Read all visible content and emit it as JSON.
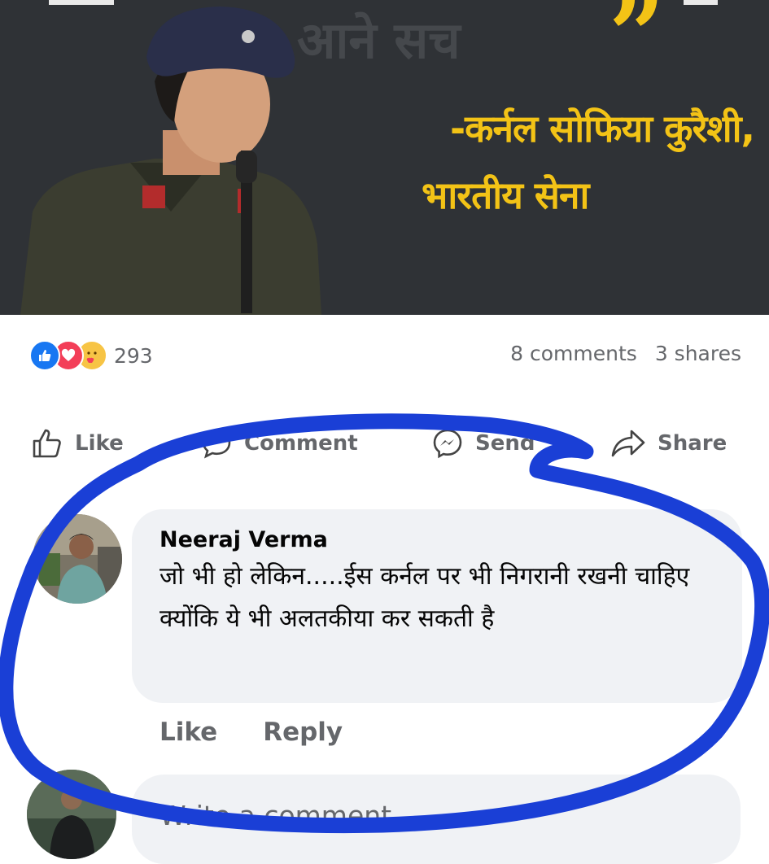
{
  "post_image": {
    "background_text": "आने सच",
    "quote_glyph": "”",
    "caption_line1": "-कर्नल सोफिया कुरैशी,",
    "caption_line2": "भारतीय सेना"
  },
  "reactions": {
    "icons": [
      "like-icon",
      "love-icon",
      "care-icon"
    ],
    "count": "293"
  },
  "stats": {
    "comments": "8 comments",
    "shares": "3 shares"
  },
  "actions": {
    "like": "Like",
    "comment": "Comment",
    "send": "Send",
    "share": "Share"
  },
  "comment": {
    "author": "Neeraj Verma",
    "text": "जो भी हो लेकिन.....ईस कर्नल पर भी निगरानी रखनी चाहिए क्योंकि ये भी अलतकीया कर सकती है",
    "like_label": "Like",
    "reply_label": "Reply"
  },
  "composer": {
    "placeholder": "Write a comment..."
  },
  "colors": {
    "annotation": "#1a3fd6",
    "caption": "#f3c316",
    "like": "#1877f2",
    "love": "#f33e58"
  }
}
